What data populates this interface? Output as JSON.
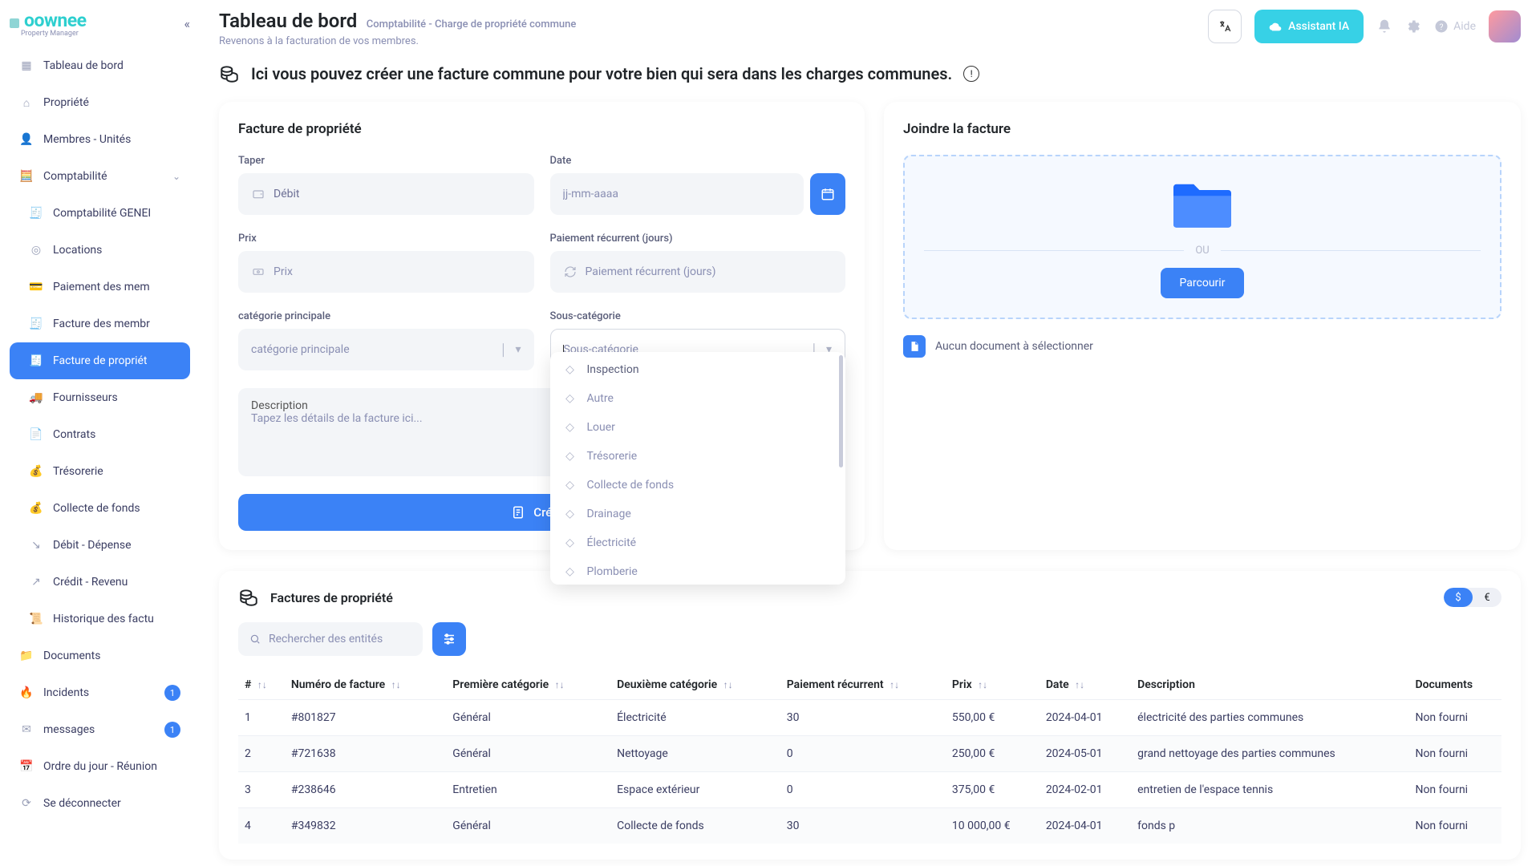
{
  "brand": {
    "name": "oownee",
    "tag": "Property Manager"
  },
  "header": {
    "title": "Tableau de bord",
    "crumb": "Comptabilité - Charge de propriété commune",
    "subline": "Revenons à la facturation de vos membres.",
    "ai": "Assistant IA",
    "help": "Aide"
  },
  "banner": "Ici vous pouvez créer une facture commune pour votre bien qui sera dans les charges communes.",
  "sidebar": [
    {
      "label": "Tableau de bord"
    },
    {
      "label": "Propriété"
    },
    {
      "label": "Membres - Unités"
    },
    {
      "label": "Comptabilité",
      "chev": true
    },
    {
      "label": "Comptabilité GENEI",
      "sub": true
    },
    {
      "label": "Locations",
      "sub": true
    },
    {
      "label": "Paiement des mem",
      "sub": true
    },
    {
      "label": "Facture des membr",
      "sub": true
    },
    {
      "label": "Facture de propriét",
      "sub": true,
      "active": true
    },
    {
      "label": "Fournisseurs",
      "sub": true
    },
    {
      "label": "Contrats",
      "sub": true
    },
    {
      "label": "Trésorerie",
      "sub": true
    },
    {
      "label": "Collecte de fonds",
      "sub": true
    },
    {
      "label": "Débit - Dépense",
      "sub": true
    },
    {
      "label": "Crédit - Revenu",
      "sub": true
    },
    {
      "label": "Historique des factu",
      "sub": true
    },
    {
      "label": "Documents"
    },
    {
      "label": "Incidents",
      "badge": "1"
    },
    {
      "label": "messages",
      "badge": "1"
    },
    {
      "label": "Ordre du jour - Réunion"
    },
    {
      "label": "Se déconnecter"
    }
  ],
  "form": {
    "card_title": "Facture de propriété",
    "type_label": "Taper",
    "type_value": "Débit",
    "date_label": "Date",
    "date_value": "jj-mm-aaaa",
    "price_label": "Prix",
    "price_ph": "Prix",
    "recur_label": "Paiement récurrent (jours)",
    "recur_ph": "Paiement récurrent (jours)",
    "cat_label": "catégorie principale",
    "cat_ph": "catégorie principale",
    "subcat_label": "Sous-catégorie",
    "subcat_ph": "Sous-catégorie",
    "desc_label": "Description",
    "desc_ph": "Tapez les détails de la facture ici...",
    "create": "Créer u"
  },
  "subcat_options": [
    "Inspection",
    "Autre",
    "Louer",
    "Trésorerie",
    "Collecte de fonds",
    "Drainage",
    "Électricité",
    "Plomberie"
  ],
  "attach": {
    "title": "Joindre la facture",
    "or": "OU",
    "browse": "Parcourir",
    "nodoc": "Aucun document à sélectionner"
  },
  "table": {
    "title": "Factures de propriété",
    "search_ph": "Rechercher des entités",
    "curr_on": "$",
    "curr_off": "€",
    "cols": [
      "#",
      "Numéro de facture",
      "Première catégorie",
      "Deuxième catégorie",
      "Paiement récurrent",
      "Prix",
      "Date",
      "Description",
      "Documents"
    ],
    "rows": [
      {
        "n": "1",
        "num": "#801827",
        "c1": "Général",
        "c2": "Électricité",
        "rec": "30",
        "price": "550,00 €",
        "date": "2024-04-01",
        "desc": "électricité des parties communes",
        "doc": "Non fourni"
      },
      {
        "n": "2",
        "num": "#721638",
        "c1": "Général",
        "c2": "Nettoyage",
        "rec": "0",
        "price": "250,00 €",
        "date": "2024-05-01",
        "desc": "grand nettoyage des parties communes",
        "doc": "Non fourni"
      },
      {
        "n": "3",
        "num": "#238646",
        "c1": "Entretien",
        "c2": "Espace extérieur",
        "rec": "0",
        "price": "375,00 €",
        "date": "2024-02-01",
        "desc": "entretien de l'espace tennis",
        "doc": "Non fourni"
      },
      {
        "n": "4",
        "num": "#349832",
        "c1": "Général",
        "c2": "Collecte de fonds",
        "rec": "30",
        "price": "10 000,00 €",
        "date": "2024-04-01",
        "desc": "fonds p",
        "doc": "Non fourni"
      }
    ]
  }
}
